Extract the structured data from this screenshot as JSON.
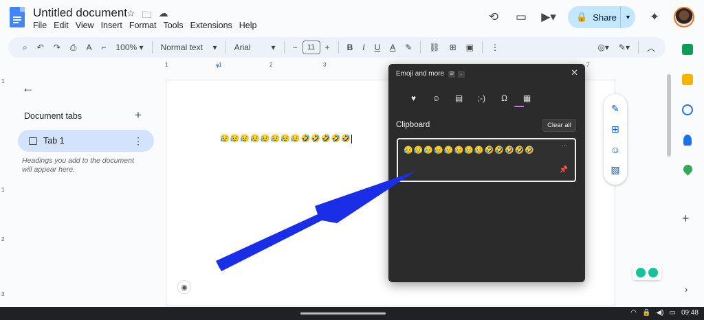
{
  "header": {
    "doc_title": "Untitled document",
    "menu": [
      "File",
      "Edit",
      "View",
      "Insert",
      "Format",
      "Tools",
      "Extensions",
      "Help"
    ],
    "share_label": "Share"
  },
  "toolbar": {
    "zoom": "100%",
    "style": "Normal text",
    "font": "Arial",
    "font_size": "11"
  },
  "ruler": {
    "marks": [
      "1",
      "1",
      "2",
      "3",
      "7"
    ],
    "vmarks": [
      "1",
      "1",
      "2",
      "3"
    ]
  },
  "left_panel": {
    "title": "Document tabs",
    "tab_label": "Tab 1",
    "hint": "Headings you add to the document will appear here."
  },
  "document": {
    "text": "😥😥😥😥😥😥😥😥🤣🤣🤣🤣🤣"
  },
  "emoji_panel": {
    "title": "Emoji and more",
    "section": "Clipboard",
    "clear_all": "Clear all",
    "clip_content": "😥😥😥😥😥😥😥😥🤣🤣🤣🤣🤣"
  },
  "status": {
    "time": "09:48"
  },
  "colors": {
    "accent": "#0b57d0",
    "share_bg": "#c2e7ff",
    "tab_selected": "#d3e3fd",
    "panel_bg": "#2b2b2b",
    "annotation_arrow": "#1a2ee8"
  }
}
